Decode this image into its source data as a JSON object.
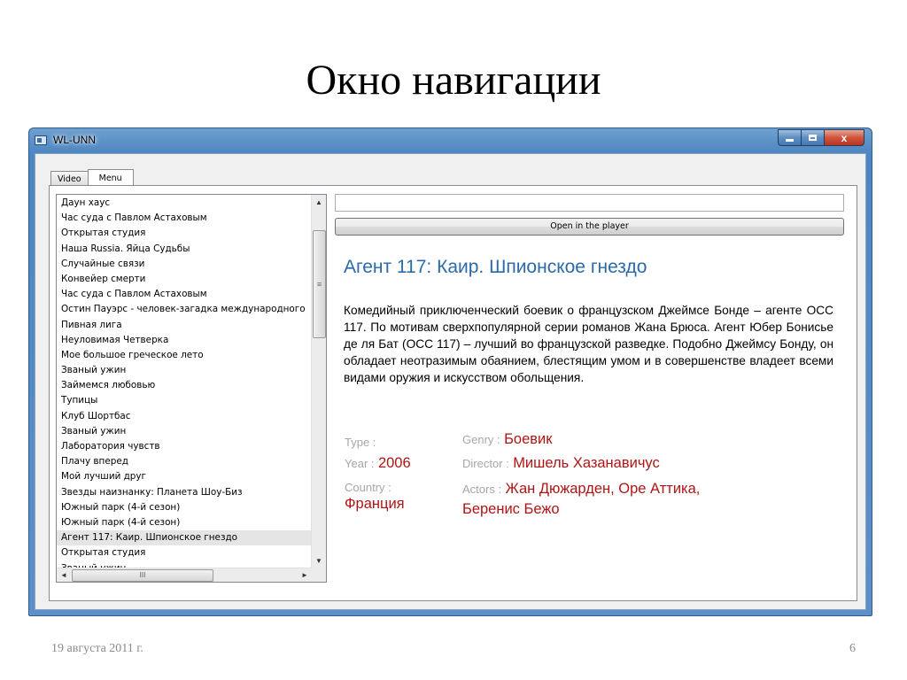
{
  "slide": {
    "title": "Окно навигации",
    "date": "19 августа 2011 г.",
    "page_number": "6"
  },
  "window": {
    "title": "WL-UNN",
    "caption_buttons": {
      "minimize": "minimize-icon",
      "maximize": "maximize-icon",
      "close": "x"
    }
  },
  "tabs": [
    {
      "label": "Video",
      "active": false
    },
    {
      "label": "Menu",
      "active": true
    }
  ],
  "list": {
    "items": [
      "Даун хаус",
      "Час суда с Павлом Астаховым",
      "Открытая студия",
      "Наша Russia. Яйца Судьбы",
      "Случайные связи",
      "Конвейер смерти",
      "Час суда с Павлом Астаховым",
      "Остин Пауэрс - человек-загадка международного",
      "Пивная лига",
      "Неуловимая Четверка",
      "Мое большое греческое лето",
      "Званый ужин",
      "Займемся любовью",
      "Тупицы",
      "Клуб Шортбас",
      "Званый ужин",
      "Лаборатория чувств",
      "Плачу вперед",
      "Мой лучший друг",
      "Звезды наизнанку: Планета Шоу-Биз",
      "Южный парк (4-й сезон)",
      "Южный парк (4-й сезон)",
      "Агент 117: Каир. Шпионское гнездо",
      "Открытая студия",
      "Званый ужин"
    ],
    "selected_index": 22,
    "scroll_grip_vertical": "≡",
    "scroll_grip_horizontal": "III",
    "arrow_up": "▲",
    "arrow_down": "▼",
    "arrow_left": "◄",
    "arrow_right": "►"
  },
  "details": {
    "url_value": "",
    "open_button_label": "Open in the player",
    "title": "Агент 117: Каир. Шпионское гнездо",
    "description": "Комедийный приключенческий боевик о французском Джеймсе Бонде – агенте ОСС 117. По мотивам сверхпопулярной серии романов Жана Брюса. Агент Юбер Бонисье де ля Бат (ОСС 117) – лучший во французской разведке. Подобно Джеймсу Бонду, он обладает неотразимым обаянием, блестящим умом и в совершенстве владеет всеми видами оружия и искусством обольщения.",
    "type_label": "Type :",
    "type_value": "",
    "genre_label": "Genry :",
    "genre_value": "Боевик",
    "year_label": "Year :",
    "year_value": "2006",
    "director_label": "Director :",
    "director_value": "Мишель Хазанавичус",
    "country_label": "Country :",
    "country_value": "Франция",
    "actors_label": "Actors :",
    "actors_value_line1": "Жан Дюжарден, Оре Аттика,",
    "actors_value_line2": "Беренис Бежо"
  },
  "colors": {
    "accent_title": "#2c6aa8",
    "value_red": "#b01515",
    "label_gray": "#a7a7a7"
  }
}
